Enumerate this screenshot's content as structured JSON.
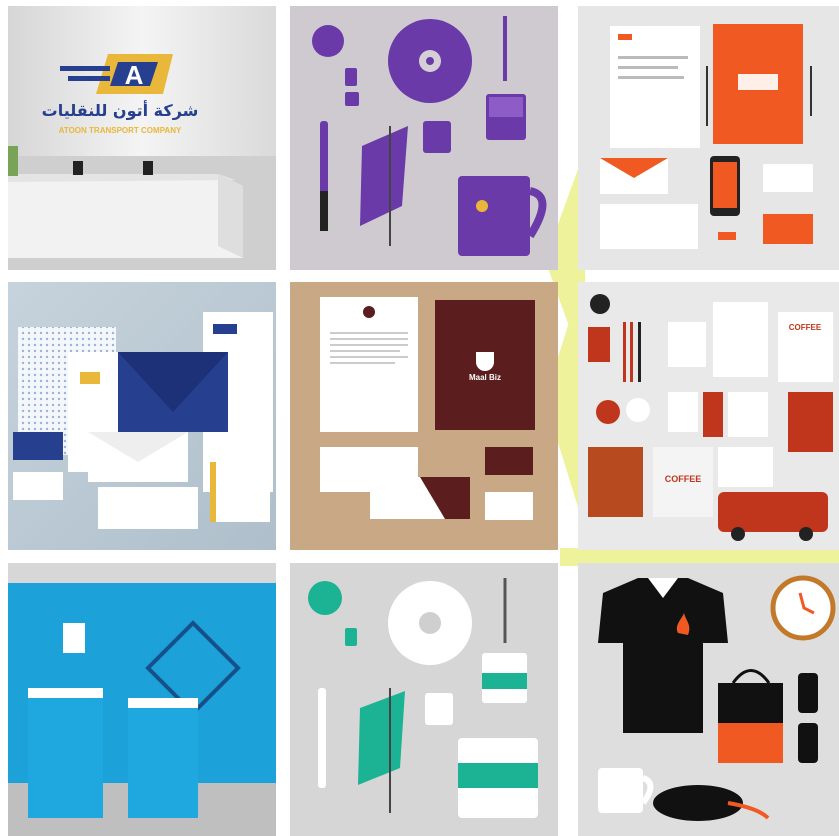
{
  "colors": {
    "accent_yellow": "#eef29a",
    "atoon_blue": "#263f8f",
    "atoon_gold": "#e9b83a",
    "purple": "#6a3aa8",
    "orange": "#f05a22",
    "brown": "#5b1d1e",
    "coffee_red": "#c0361c",
    "sky_blue": "#1fa8e0",
    "teal": "#1bb393",
    "black": "#111111"
  },
  "tiles": [
    {
      "name": "reception-desk-atoon",
      "logo_arabic": "شركة أتون للنقليات",
      "logo_english": "ATOON TRANSPORT COMPANY"
    },
    {
      "name": "purple-stationery"
    },
    {
      "name": "orange-stationery"
    },
    {
      "name": "atoon-stationery"
    },
    {
      "name": "brown-coffee-stationery",
      "brand": "Maal Biz"
    },
    {
      "name": "coffee-red-stationery",
      "brand": "COFFEE"
    },
    {
      "name": "blue-exhibition-booth"
    },
    {
      "name": "teal-stationery"
    },
    {
      "name": "black-polo-merch"
    }
  ]
}
